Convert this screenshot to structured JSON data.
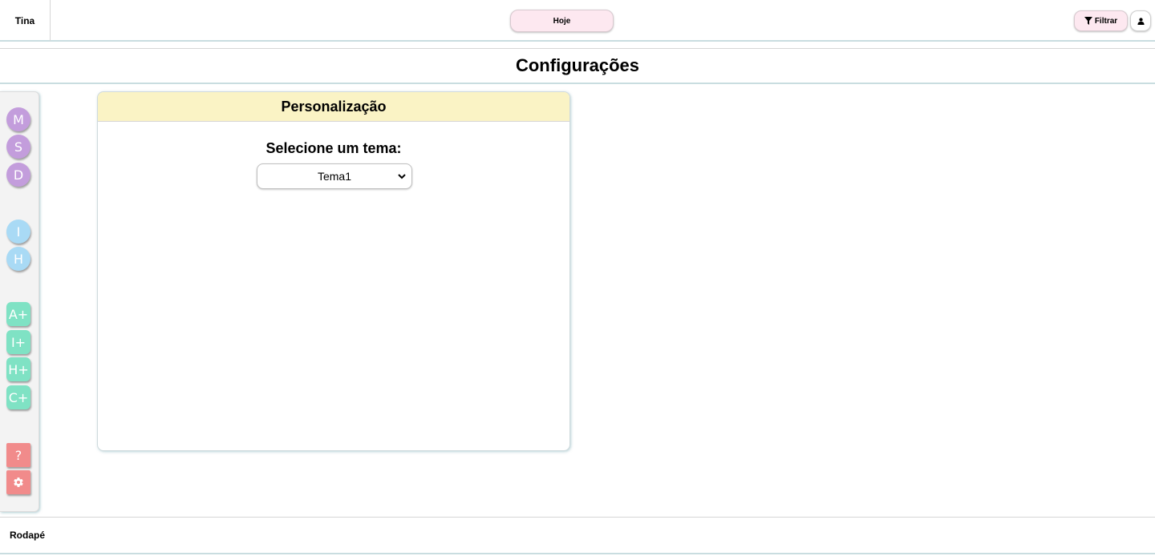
{
  "header": {
    "brand": "Tina",
    "today_label": "Hoje",
    "filter_label": "Filtrar",
    "filter_icon": "filter-icon",
    "user_icon": "user-icon"
  },
  "page": {
    "title": "Configurações"
  },
  "sidebar": {
    "group1": [
      "M",
      "S",
      "D"
    ],
    "group2": [
      "I",
      "H"
    ],
    "group3": [
      "A+",
      "I+",
      "H+",
      "C+"
    ],
    "help_label": "?",
    "settings_icon": "gear-icon",
    "colors": {
      "purple": "#c39ddc",
      "blue": "#a9daf5",
      "green": "#7fe2c4",
      "red": "#f18b8b"
    }
  },
  "card": {
    "title": "Personalização",
    "theme_label": "Selecione um tema:",
    "theme_value": "Tema1"
  },
  "footer": {
    "text": "Rodapé"
  },
  "colors": {
    "accent_pink": "#fde8f0",
    "card_header": "#faf3c5",
    "border_teal": "#c9dde0"
  }
}
